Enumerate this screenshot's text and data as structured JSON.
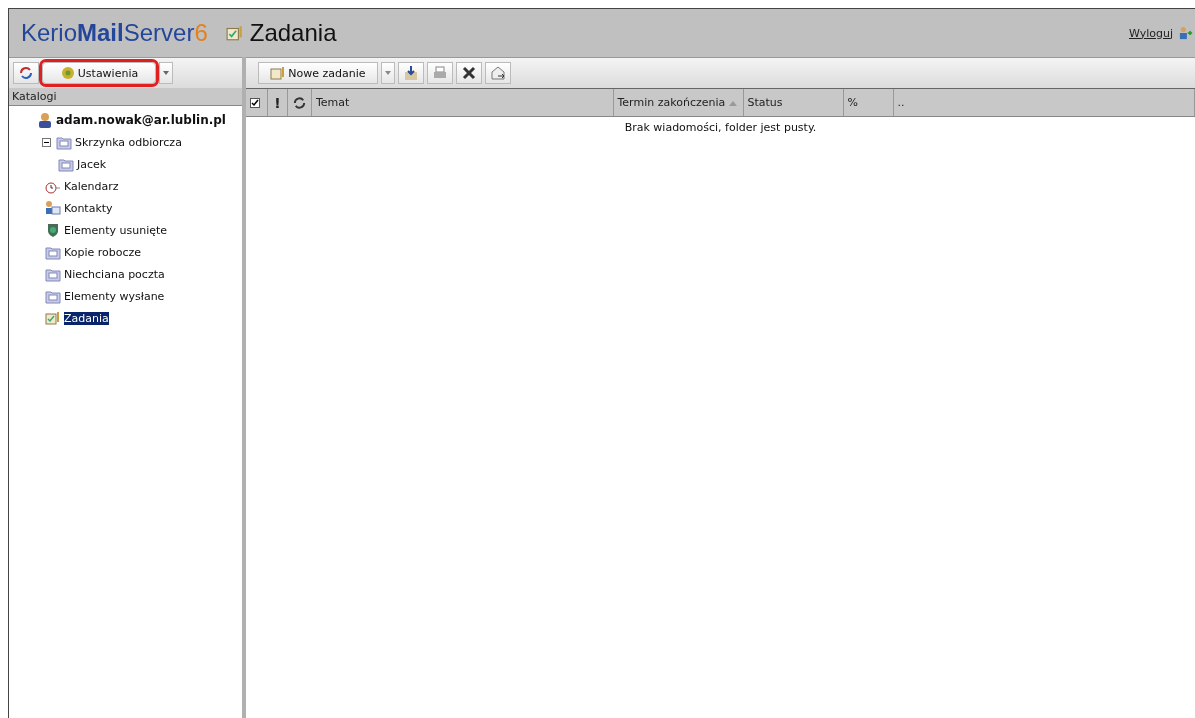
{
  "logo": {
    "brand": "Kerio",
    "product": "Mail",
    "suffix": "Server",
    "version": "6"
  },
  "page_title": "Zadania",
  "logout": "Wyloguj",
  "sidebar": {
    "settings_button": "Ustawienia",
    "settings_highlighted": true,
    "header": "Katalogi",
    "tree": [
      {
        "label": "adam.nowak@ar.lublin.pl",
        "kind": "account",
        "selected": false,
        "children": [
          {
            "label": "Skrzynka odbiorcza",
            "kind": "folder",
            "selected": false,
            "expanded": true,
            "children": [
              {
                "label": "Jacek",
                "kind": "folder",
                "selected": false
              }
            ]
          },
          {
            "label": "Kalendarz",
            "kind": "calendar",
            "selected": false
          },
          {
            "label": "Kontakty",
            "kind": "contacts",
            "selected": false
          },
          {
            "label": "Elementy usunięte",
            "kind": "trash",
            "selected": false
          },
          {
            "label": "Kopie robocze",
            "kind": "folder",
            "selected": false
          },
          {
            "label": "Niechciana poczta",
            "kind": "folder",
            "selected": false
          },
          {
            "label": "Elementy wysłane",
            "kind": "folder",
            "selected": false
          },
          {
            "label": "Zadania",
            "kind": "tasks",
            "selected": true
          }
        ]
      }
    ]
  },
  "toolbar": {
    "new_button": "Nowe zadanie"
  },
  "table": {
    "columns": [
      {
        "kind": "check",
        "checked": true
      },
      {
        "kind": "priority",
        "label": "!"
      },
      {
        "kind": "sync"
      },
      {
        "kind": "text",
        "label": "Temat"
      },
      {
        "kind": "text",
        "label": "Termin zakończenia",
        "sorted": true
      },
      {
        "kind": "text",
        "label": "Status"
      },
      {
        "kind": "text",
        "label": "%"
      },
      {
        "kind": "text",
        "label": ".."
      }
    ],
    "empty_message": "Brak wiadomości, folder jest pusty."
  }
}
